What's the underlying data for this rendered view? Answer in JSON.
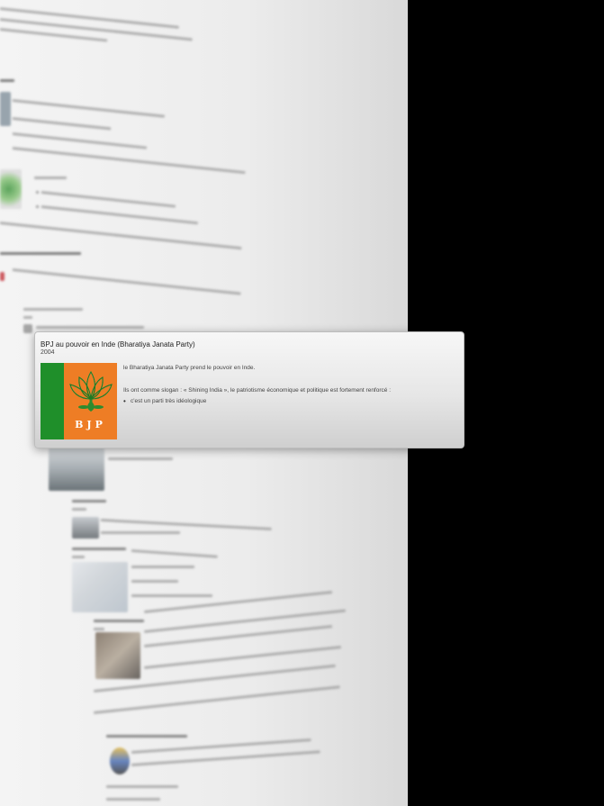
{
  "popup": {
    "title": "BPJ au pouvoir en Inde (Bharatiya Janata Party)",
    "year": "2004",
    "logo_text": "BJP",
    "paragraph1": "le Bharatiya Janata Party prend le pouvoir en Inde.",
    "paragraph2": "Ils ont comme slogan : « Shining India », le patriotisme économique et politique est fortement renforcé :",
    "bullet1": "c'est un parti très idéologique"
  },
  "colors": {
    "logo_green": "#1f8f2a",
    "logo_orange": "#ee7d25",
    "background": "#000000"
  },
  "icons": [
    "lotus-icon"
  ]
}
